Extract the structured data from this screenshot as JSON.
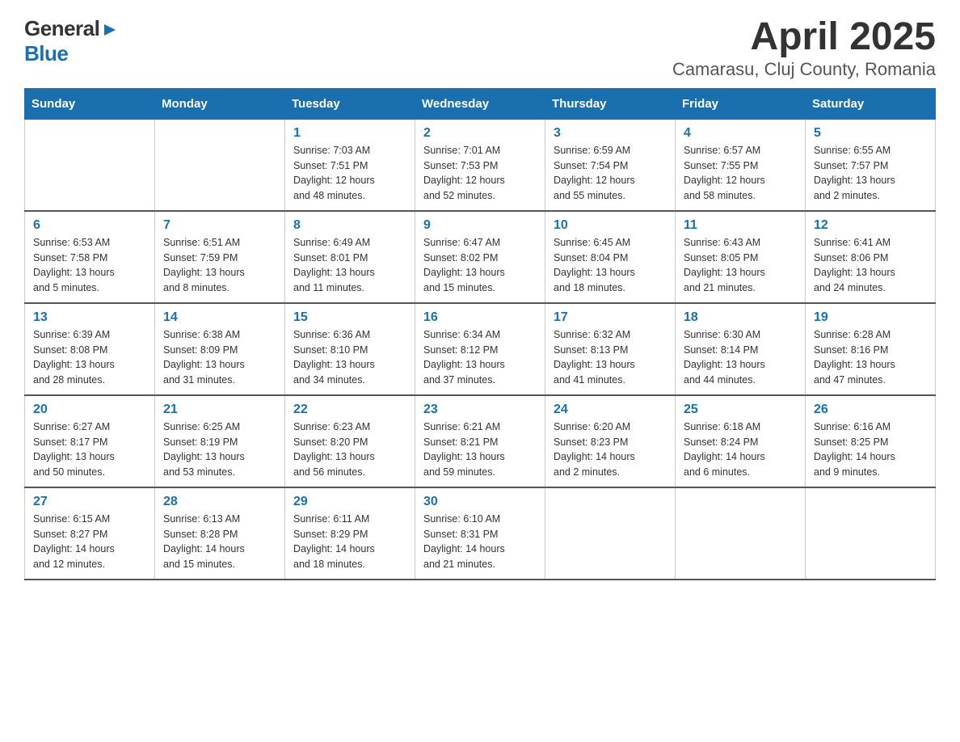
{
  "logo": {
    "general": "General",
    "blue": "Blue"
  },
  "title": "April 2025",
  "subtitle": "Camarasu, Cluj County, Romania",
  "weekdays": [
    "Sunday",
    "Monday",
    "Tuesday",
    "Wednesday",
    "Thursday",
    "Friday",
    "Saturday"
  ],
  "weeks": [
    [
      {
        "day": "",
        "info": ""
      },
      {
        "day": "",
        "info": ""
      },
      {
        "day": "1",
        "info": "Sunrise: 7:03 AM\nSunset: 7:51 PM\nDaylight: 12 hours\nand 48 minutes."
      },
      {
        "day": "2",
        "info": "Sunrise: 7:01 AM\nSunset: 7:53 PM\nDaylight: 12 hours\nand 52 minutes."
      },
      {
        "day": "3",
        "info": "Sunrise: 6:59 AM\nSunset: 7:54 PM\nDaylight: 12 hours\nand 55 minutes."
      },
      {
        "day": "4",
        "info": "Sunrise: 6:57 AM\nSunset: 7:55 PM\nDaylight: 12 hours\nand 58 minutes."
      },
      {
        "day": "5",
        "info": "Sunrise: 6:55 AM\nSunset: 7:57 PM\nDaylight: 13 hours\nand 2 minutes."
      }
    ],
    [
      {
        "day": "6",
        "info": "Sunrise: 6:53 AM\nSunset: 7:58 PM\nDaylight: 13 hours\nand 5 minutes."
      },
      {
        "day": "7",
        "info": "Sunrise: 6:51 AM\nSunset: 7:59 PM\nDaylight: 13 hours\nand 8 minutes."
      },
      {
        "day": "8",
        "info": "Sunrise: 6:49 AM\nSunset: 8:01 PM\nDaylight: 13 hours\nand 11 minutes."
      },
      {
        "day": "9",
        "info": "Sunrise: 6:47 AM\nSunset: 8:02 PM\nDaylight: 13 hours\nand 15 minutes."
      },
      {
        "day": "10",
        "info": "Sunrise: 6:45 AM\nSunset: 8:04 PM\nDaylight: 13 hours\nand 18 minutes."
      },
      {
        "day": "11",
        "info": "Sunrise: 6:43 AM\nSunset: 8:05 PM\nDaylight: 13 hours\nand 21 minutes."
      },
      {
        "day": "12",
        "info": "Sunrise: 6:41 AM\nSunset: 8:06 PM\nDaylight: 13 hours\nand 24 minutes."
      }
    ],
    [
      {
        "day": "13",
        "info": "Sunrise: 6:39 AM\nSunset: 8:08 PM\nDaylight: 13 hours\nand 28 minutes."
      },
      {
        "day": "14",
        "info": "Sunrise: 6:38 AM\nSunset: 8:09 PM\nDaylight: 13 hours\nand 31 minutes."
      },
      {
        "day": "15",
        "info": "Sunrise: 6:36 AM\nSunset: 8:10 PM\nDaylight: 13 hours\nand 34 minutes."
      },
      {
        "day": "16",
        "info": "Sunrise: 6:34 AM\nSunset: 8:12 PM\nDaylight: 13 hours\nand 37 minutes."
      },
      {
        "day": "17",
        "info": "Sunrise: 6:32 AM\nSunset: 8:13 PM\nDaylight: 13 hours\nand 41 minutes."
      },
      {
        "day": "18",
        "info": "Sunrise: 6:30 AM\nSunset: 8:14 PM\nDaylight: 13 hours\nand 44 minutes."
      },
      {
        "day": "19",
        "info": "Sunrise: 6:28 AM\nSunset: 8:16 PM\nDaylight: 13 hours\nand 47 minutes."
      }
    ],
    [
      {
        "day": "20",
        "info": "Sunrise: 6:27 AM\nSunset: 8:17 PM\nDaylight: 13 hours\nand 50 minutes."
      },
      {
        "day": "21",
        "info": "Sunrise: 6:25 AM\nSunset: 8:19 PM\nDaylight: 13 hours\nand 53 minutes."
      },
      {
        "day": "22",
        "info": "Sunrise: 6:23 AM\nSunset: 8:20 PM\nDaylight: 13 hours\nand 56 minutes."
      },
      {
        "day": "23",
        "info": "Sunrise: 6:21 AM\nSunset: 8:21 PM\nDaylight: 13 hours\nand 59 minutes."
      },
      {
        "day": "24",
        "info": "Sunrise: 6:20 AM\nSunset: 8:23 PM\nDaylight: 14 hours\nand 2 minutes."
      },
      {
        "day": "25",
        "info": "Sunrise: 6:18 AM\nSunset: 8:24 PM\nDaylight: 14 hours\nand 6 minutes."
      },
      {
        "day": "26",
        "info": "Sunrise: 6:16 AM\nSunset: 8:25 PM\nDaylight: 14 hours\nand 9 minutes."
      }
    ],
    [
      {
        "day": "27",
        "info": "Sunrise: 6:15 AM\nSunset: 8:27 PM\nDaylight: 14 hours\nand 12 minutes."
      },
      {
        "day": "28",
        "info": "Sunrise: 6:13 AM\nSunset: 8:28 PM\nDaylight: 14 hours\nand 15 minutes."
      },
      {
        "day": "29",
        "info": "Sunrise: 6:11 AM\nSunset: 8:29 PM\nDaylight: 14 hours\nand 18 minutes."
      },
      {
        "day": "30",
        "info": "Sunrise: 6:10 AM\nSunset: 8:31 PM\nDaylight: 14 hours\nand 21 minutes."
      },
      {
        "day": "",
        "info": ""
      },
      {
        "day": "",
        "info": ""
      },
      {
        "day": "",
        "info": ""
      }
    ]
  ]
}
